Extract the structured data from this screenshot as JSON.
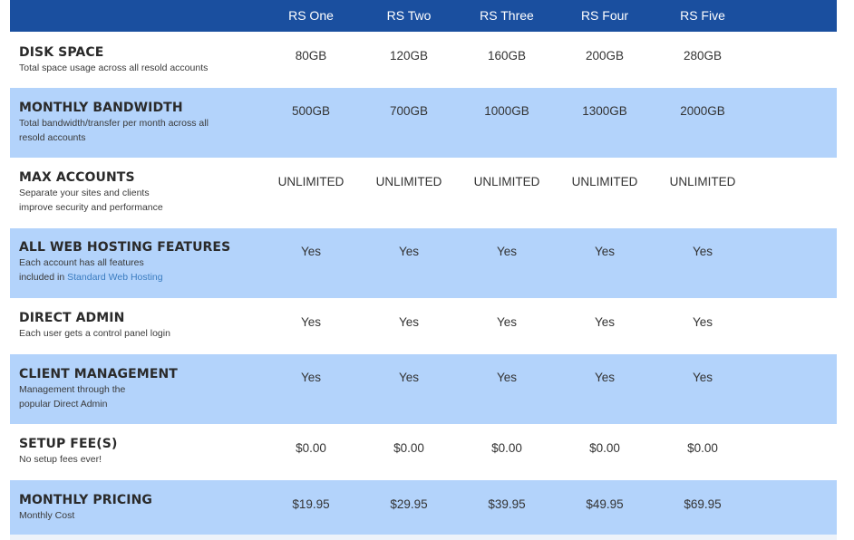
{
  "columns": [
    "RS One",
    "RS Two",
    "RS Three",
    "RS Four",
    "RS Five"
  ],
  "rows": [
    {
      "title": "DISK SPACE",
      "desc": "Total space usage across all resold accounts",
      "values": [
        "80GB",
        "120GB",
        "160GB",
        "200GB",
        "280GB"
      ]
    },
    {
      "title": "MONTHLY BANDWIDTH",
      "desc": "Total bandwidth/transfer per month across all\nresold accounts",
      "values": [
        "500GB",
        "700GB",
        "1000GB",
        "1300GB",
        "2000GB"
      ]
    },
    {
      "title": "MAX ACCOUNTS",
      "desc": "Separate your sites and clients\nimprove security and performance",
      "values": [
        "UNLIMITED",
        "UNLIMITED",
        "UNLIMITED",
        "UNLIMITED",
        "UNLIMITED"
      ]
    },
    {
      "title": "ALL WEB HOSTING FEATURES",
      "desc": "Each account has all features\nincluded in ",
      "link": "Standard Web Hosting",
      "values": [
        "Yes",
        "Yes",
        "Yes",
        "Yes",
        "Yes"
      ]
    },
    {
      "title": "DIRECT ADMIN",
      "desc": "Each user gets a control panel login",
      "values": [
        "Yes",
        "Yes",
        "Yes",
        "Yes",
        "Yes"
      ]
    },
    {
      "title": "CLIENT MANAGEMENT",
      "desc": "Management through the\npopular Direct Admin",
      "values": [
        "Yes",
        "Yes",
        "Yes",
        "Yes",
        "Yes"
      ]
    },
    {
      "title": "SETUP FEE(S)",
      "desc": "No setup fees ever!",
      "values": [
        "$0.00",
        "$0.00",
        "$0.00",
        "$0.00",
        "$0.00"
      ]
    },
    {
      "title": "MONTHLY PRICING",
      "desc": "Monthly Cost",
      "values": [
        "$19.95",
        "$29.95",
        "$39.95",
        "$49.95",
        "$69.95"
      ]
    }
  ],
  "colors": {
    "header_bg": "#1a4f9f",
    "alt_row_bg": "#b3d3fb",
    "link": "#3a7cc0"
  }
}
